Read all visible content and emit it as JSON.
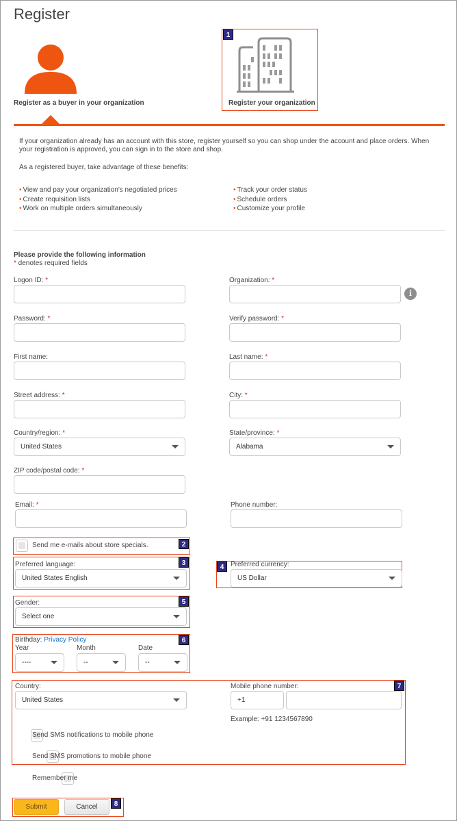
{
  "page": {
    "title": "Register"
  },
  "options": {
    "buyer": {
      "label": "Register as a buyer in your organization",
      "icon": "person-icon"
    },
    "organization": {
      "label": "Register your organization",
      "icon": "building-icon"
    }
  },
  "intro": {
    "paragraph": "If your organization already has an account with this store, register yourself so you can shop under the account and place orders. When your registration is approved, you can sign in to the store and shop.",
    "benefits_heading": "As a registered buyer, take advantage of these benefits:",
    "benefits_left": [
      "View and pay your organization's negotiated prices",
      "Create requisition lists",
      "Work on multiple orders simultaneously"
    ],
    "benefits_right": [
      "Track your order status",
      "Schedule orders",
      "Customize your profile"
    ]
  },
  "form": {
    "heading": "Please provide the following information",
    "required_marker": "*",
    "required_note": " denotes required fields",
    "fields": {
      "logon_id": {
        "label": "Logon ID:",
        "required": true,
        "value": ""
      },
      "organization": {
        "label": "Organization:",
        "required": true,
        "value": "",
        "info_icon": "i"
      },
      "password": {
        "label": "Password:",
        "required": true,
        "value": ""
      },
      "verify_password": {
        "label": "Verify password:",
        "required": true,
        "value": ""
      },
      "first_name": {
        "label": "First name:",
        "required": false,
        "value": ""
      },
      "last_name": {
        "label": "Last name:",
        "required": true,
        "value": ""
      },
      "street_address": {
        "label": "Street address:",
        "required": true,
        "value": ""
      },
      "city": {
        "label": "City:",
        "required": true,
        "value": ""
      },
      "country_region": {
        "label": "Country/region:",
        "required": true,
        "selected": "United States"
      },
      "state_province": {
        "label": "State/province:",
        "required": true,
        "selected": "Alabama"
      },
      "zip": {
        "label": "ZIP code/postal code:",
        "required": true,
        "value": ""
      },
      "email": {
        "label": "Email:",
        "required": true,
        "value": ""
      },
      "phone": {
        "label": "Phone number:",
        "required": false,
        "value": ""
      },
      "store_specials": {
        "label": "Send me e-mails about store specials.",
        "checked": false
      },
      "preferred_language": {
        "label": "Preferred language:",
        "selected": "United States English"
      },
      "preferred_currency": {
        "label": "Preferred currency:",
        "selected": "US Dollar"
      },
      "gender": {
        "label": "Gender:",
        "selected": "Select one"
      },
      "birthday": {
        "label": "Birthday:",
        "privacy_link": "Privacy Policy",
        "year": {
          "label": "Year",
          "selected": "----"
        },
        "month": {
          "label": "Month",
          "selected": "--"
        },
        "date": {
          "label": "Date",
          "selected": "--"
        }
      },
      "mobile_country": {
        "label": "Country:",
        "selected": "United States"
      },
      "mobile_phone": {
        "label": "Mobile phone number:",
        "country_code": "+1",
        "value": "",
        "example": "Example: +91 1234567890"
      },
      "sms_notifications": {
        "label": "Send SMS notifications to mobile phone",
        "checked": false
      },
      "sms_promotions": {
        "label": "Send SMS promotions to mobile phone",
        "checked": false
      },
      "remember_me": {
        "label": "Remember me",
        "checked": false
      }
    },
    "buttons": {
      "submit": "Submit",
      "cancel": "Cancel"
    }
  },
  "callouts": [
    "1",
    "2",
    "3",
    "4",
    "5",
    "6",
    "7",
    "8"
  ],
  "colors": {
    "accent": "#ee5511",
    "callout_border": "#e8461c",
    "badge_bg": "#2e2a86",
    "submit_bg": "#fbb61c",
    "required": "#e0262b",
    "link": "#1a73c7"
  }
}
